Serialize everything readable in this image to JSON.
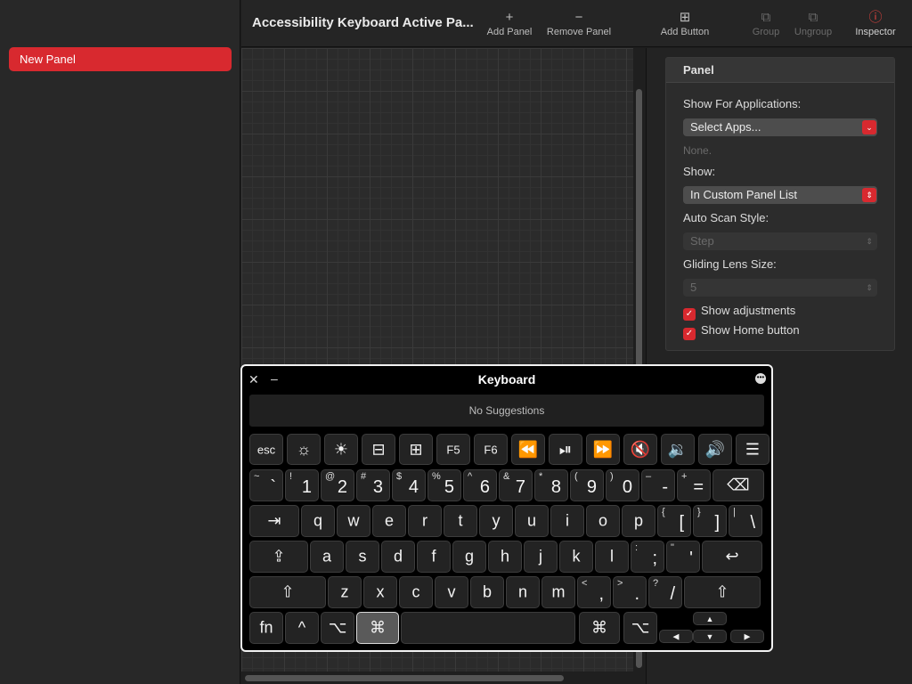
{
  "sidebar": {
    "items": [
      {
        "label": "New Panel"
      }
    ]
  },
  "toolbar": {
    "title": "Accessibility Keyboard Active Pa...",
    "buttons": [
      {
        "label": "Add Panel",
        "icon": "plus-icon",
        "glyph": "+"
      },
      {
        "label": "Remove Panel",
        "icon": "minus-icon",
        "glyph": "−"
      },
      {
        "label": "Add Button",
        "icon": "add-button-icon",
        "glyph": "⊞"
      },
      {
        "label": "Group",
        "icon": "group-icon",
        "glyph": "⧉"
      },
      {
        "label": "Ungroup",
        "icon": "ungroup-icon",
        "glyph": "⧉"
      },
      {
        "label": "Inspector",
        "icon": "info-icon",
        "glyph": "ⓘ"
      }
    ]
  },
  "inspector": {
    "header": "Panel",
    "show_for_apps_label": "Show For Applications:",
    "select_apps_value": "Select Apps...",
    "apps_none": "None.",
    "show_label": "Show:",
    "show_value": "In Custom Panel List",
    "auto_scan_label": "Auto Scan Style:",
    "auto_scan_value": "Step",
    "gliding_lens_label": "Gliding Lens Size:",
    "gliding_lens_value": "5",
    "show_adjustments": "Show adjustments",
    "show_home_button": "Show Home button"
  },
  "keyboard": {
    "title": "Keyboard",
    "suggestions": "No Suggestions",
    "rows": {
      "function": [
        {
          "c": "esc"
        },
        {
          "c": "☼",
          "icon": "brightness-down-icon"
        },
        {
          "c": "☀",
          "icon": "brightness-up-icon"
        },
        {
          "c": "⊟",
          "icon": "mission-control-icon"
        },
        {
          "c": "⊞",
          "icon": "launchpad-icon"
        },
        {
          "c": "F5"
        },
        {
          "c": "F6"
        },
        {
          "c": "⏪",
          "icon": "rewind-icon"
        },
        {
          "c": "⏯",
          "icon": "play-pause-icon"
        },
        {
          "c": "⏩",
          "icon": "fast-forward-icon"
        },
        {
          "c": "🔇",
          "icon": "mute-icon"
        },
        {
          "c": "🔉",
          "icon": "volume-down-icon"
        },
        {
          "c": "🔊",
          "icon": "volume-up-icon"
        },
        {
          "c": "☰",
          "icon": "list-icon"
        }
      ],
      "number": [
        {
          "sh": "~",
          "bk": "`"
        },
        {
          "sh": "!",
          "bk": "1"
        },
        {
          "sh": "@",
          "bk": "2"
        },
        {
          "sh": "#",
          "bk": "3"
        },
        {
          "sh": "$",
          "bk": "4"
        },
        {
          "sh": "%",
          "bk": "5"
        },
        {
          "sh": "^",
          "bk": "6"
        },
        {
          "sh": "&",
          "bk": "7"
        },
        {
          "sh": "*",
          "bk": "8"
        },
        {
          "sh": "(",
          "bk": "9"
        },
        {
          "sh": ")",
          "bk": "0"
        },
        {
          "sh": "–",
          "bk": "-"
        },
        {
          "sh": "+",
          "bk": "="
        },
        {
          "c": "⌫",
          "icon": "delete-icon"
        }
      ],
      "qwerty": [
        {
          "c": "⇥",
          "icon": "tab-icon"
        },
        {
          "c": "q"
        },
        {
          "c": "w"
        },
        {
          "c": "e"
        },
        {
          "c": "r"
        },
        {
          "c": "t"
        },
        {
          "c": "y"
        },
        {
          "c": "u"
        },
        {
          "c": "i"
        },
        {
          "c": "o"
        },
        {
          "c": "p"
        },
        {
          "sh": "{",
          "bk": "["
        },
        {
          "sh": "}",
          "bk": "]"
        },
        {
          "sh": "|",
          "bk": "\\"
        }
      ],
      "asdf": [
        {
          "c": "⇪",
          "icon": "caps-lock-icon"
        },
        {
          "c": "a"
        },
        {
          "c": "s"
        },
        {
          "c": "d"
        },
        {
          "c": "f"
        },
        {
          "c": "g"
        },
        {
          "c": "h"
        },
        {
          "c": "j"
        },
        {
          "c": "k"
        },
        {
          "c": "l"
        },
        {
          "sh": ":",
          "bk": ";"
        },
        {
          "sh": "\"",
          "bk": "'"
        },
        {
          "c": "↩",
          "icon": "return-icon"
        }
      ],
      "zxcv": [
        {
          "c": "⇧",
          "icon": "shift-icon"
        },
        {
          "c": "z"
        },
        {
          "c": "x"
        },
        {
          "c": "c"
        },
        {
          "c": "v"
        },
        {
          "c": "b"
        },
        {
          "c": "n"
        },
        {
          "c": "m"
        },
        {
          "sh": "<",
          "bk": ","
        },
        {
          "sh": ">",
          "bk": "."
        },
        {
          "sh": "?",
          "bk": "/"
        },
        {
          "c": "⇧",
          "icon": "shift-icon"
        }
      ],
      "bottom": [
        {
          "c": "fn"
        },
        {
          "c": "^",
          "icon": "control-icon"
        },
        {
          "c": "⌥",
          "icon": "option-icon"
        },
        {
          "c": "⌘",
          "icon": "command-icon"
        },
        {
          "c": "",
          "icon": "space-bar"
        },
        {
          "c": "⌘",
          "icon": "command-icon"
        },
        {
          "c": "⌥",
          "icon": "option-icon"
        },
        {
          "c": "▲",
          "icon": "arrow-up-icon"
        },
        {
          "c": "◀",
          "icon": "arrow-left-icon"
        },
        {
          "c": "▼",
          "icon": "arrow-down-icon"
        },
        {
          "c": "▶",
          "icon": "arrow-right-icon"
        }
      ]
    }
  }
}
